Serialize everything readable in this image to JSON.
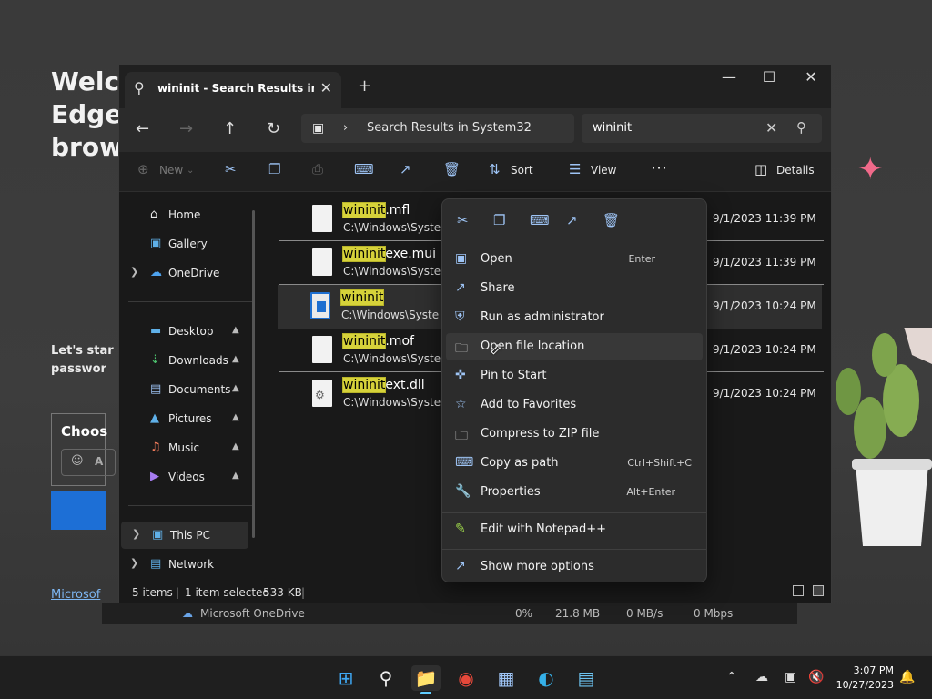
{
  "background": {
    "edge_title": "Welco\nEdge\nbrow",
    "edge_subtitle": "Let's star\npasswor",
    "edge_choose": "Choos",
    "edge_input_letter": "A",
    "edge_link": "Microsof",
    "taskmgr": {
      "name": "Microsoft OneDrive",
      "cpu": "0%",
      "memory": "21.8 MB",
      "disk": "0 MB/s",
      "network": "0 Mbps"
    }
  },
  "explorer": {
    "tab_title": "wininit - Search Results in Syst",
    "breadcrumb": "Search Results in System32",
    "search_value": "wininit",
    "toolbar": {
      "new": "New",
      "sort": "Sort",
      "view": "View",
      "details": "Details"
    },
    "sidebar": [
      {
        "label": "Home",
        "icon": "home-icon"
      },
      {
        "label": "Gallery",
        "icon": "gallery-icon"
      },
      {
        "label": "OneDrive",
        "icon": "cloud-icon"
      },
      {
        "label": "Desktop",
        "icon": "desktop-icon"
      },
      {
        "label": "Downloads",
        "icon": "download-icon"
      },
      {
        "label": "Documents",
        "icon": "documents-icon"
      },
      {
        "label": "Pictures",
        "icon": "pictures-icon"
      },
      {
        "label": "Music",
        "icon": "music-icon"
      },
      {
        "label": "Videos",
        "icon": "videos-icon"
      },
      {
        "label": "This PC",
        "icon": "pc-icon"
      },
      {
        "label": "Network",
        "icon": "network-icon"
      }
    ],
    "files": [
      {
        "match": "wininit",
        "rest": ".mfl",
        "path": "C:\\Windows\\System",
        "date": "9/1/2023 11:39 PM"
      },
      {
        "match": "wininit",
        "rest": "exe.mui",
        "path": "C:\\Windows\\System",
        "date": "9/1/2023 11:39 PM"
      },
      {
        "match": "wininit",
        "rest": "",
        "path": "C:\\Windows\\System",
        "date": "9/1/2023 10:24 PM"
      },
      {
        "match": "wininit",
        "rest": ".mof",
        "path": "C:\\Windows\\System",
        "date": "9/1/2023 10:24 PM"
      },
      {
        "match": "wininit",
        "rest": "ext.dll",
        "path": "C:\\Windows\\System",
        "date": "9/1/2023 10:24 PM"
      }
    ],
    "status": {
      "items": "5 items",
      "selected": "1 item selected",
      "size": "533 KB"
    }
  },
  "context_menu": {
    "items": [
      {
        "label": "Open",
        "shortcut": "Enter"
      },
      {
        "label": "Share",
        "shortcut": ""
      },
      {
        "label": "Run as administrator",
        "shortcut": ""
      },
      {
        "label": "Open file location",
        "shortcut": ""
      },
      {
        "label": "Pin to Start",
        "shortcut": ""
      },
      {
        "label": "Add to Favorites",
        "shortcut": ""
      },
      {
        "label": "Compress to ZIP file",
        "shortcut": ""
      },
      {
        "label": "Copy as path",
        "shortcut": "Ctrl+Shift+C"
      },
      {
        "label": "Properties",
        "shortcut": "Alt+Enter"
      },
      {
        "label": "Edit with Notepad++",
        "shortcut": ""
      },
      {
        "label": "Show more options",
        "shortcut": ""
      }
    ]
  },
  "taskbar": {
    "time": "3:07 PM",
    "date": "10/27/2023"
  }
}
